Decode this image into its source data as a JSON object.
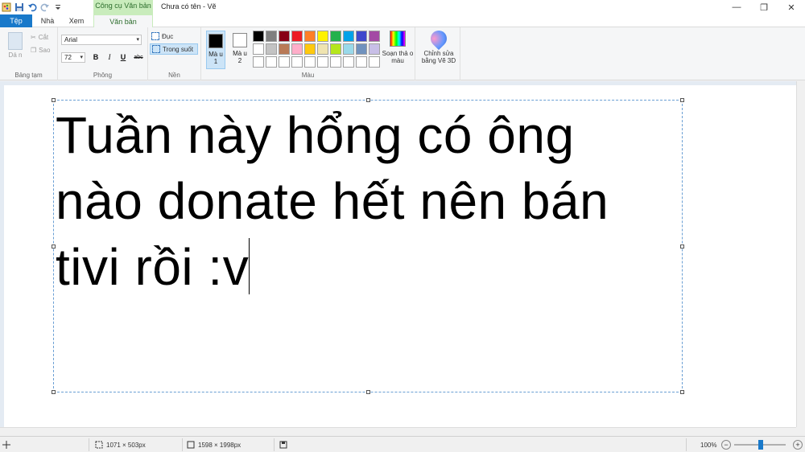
{
  "window": {
    "title": "Chưa có tên - Vẽ",
    "context_tab": "Công cụ Văn bản",
    "minimize_glyph": "—",
    "maximize_glyph": "❐",
    "close_glyph": "✕"
  },
  "tabs": {
    "file": "Tệp",
    "home": "Nhà",
    "view": "Xem",
    "text": "Văn bản"
  },
  "clipboard": {
    "paste": "Dá n",
    "cut": "Cắt",
    "copy": "Sao",
    "group_label": "Bảng tạm"
  },
  "font": {
    "family": "Arial",
    "size": "72",
    "bold": "B",
    "italic": "I",
    "underline": "U",
    "strike": "abc",
    "group_label": "Phông"
  },
  "background": {
    "opaque": "Đục",
    "transparent": "Trong suốt",
    "group_label": "Nền"
  },
  "colors": {
    "color1_label": "Mà u 1",
    "color2_label": "Mà u 2",
    "color1_value": "#000000",
    "color2_value": "#ffffff",
    "edit_colors": "Soạn thả o màu",
    "group_label": "Màu",
    "palette": [
      "#000000",
      "#7f7f7f",
      "#880015",
      "#ed1c24",
      "#ff7f27",
      "#fff200",
      "#22b14c",
      "#00a2e8",
      "#3f48cc",
      "#a349a4",
      "#ffffff",
      "#c3c3c3",
      "#b97a57",
      "#ffaec9",
      "#ffc90e",
      "#efe4b0",
      "#b5e61d",
      "#99d9ea",
      "#7092be",
      "#c8bfe7",
      "#ffffff",
      "#ffffff",
      "#ffffff",
      "#ffffff",
      "#ffffff",
      "#ffffff",
      "#ffffff",
      "#ffffff",
      "#ffffff",
      "#ffffff"
    ]
  },
  "paint3d": {
    "label": "Chỉnh sửa bằng Vẽ 3D"
  },
  "canvas": {
    "line1": "Tuần này hổng có ông",
    "line2": "nào donate hết nên bán",
    "line3": "tivi rồi :v"
  },
  "status": {
    "selection_size": "1071 × 503px",
    "image_size": "1598 × 1998px",
    "zoom": "100%"
  },
  "accent": "#1979ca"
}
